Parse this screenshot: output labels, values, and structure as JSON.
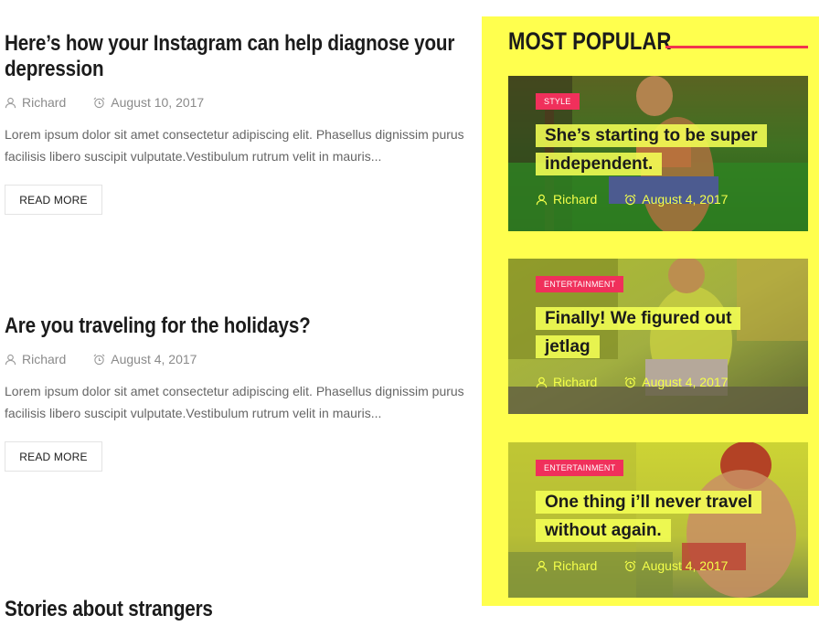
{
  "posts": [
    {
      "title": "Here’s how your Instagram can help diagnose your depression",
      "author": "Richard",
      "date": "August 10, 2017",
      "excerpt": "Lorem ipsum dolor sit amet consectetur adipiscing elit. Phasellus dignissim purus facilisis libero suscipit vulputate.Vestibulum rutrum velit in mauris...",
      "read_more": "READ MORE"
    },
    {
      "title": "Are you traveling for the holidays?",
      "author": "Richard",
      "date": "August 4, 2017",
      "excerpt": "Lorem ipsum dolor sit amet consectetur adipiscing elit. Phasellus dignissim purus facilisis libero suscipit vulputate.Vestibulum rutrum velit in mauris...",
      "read_more": "READ MORE"
    },
    {
      "title": "Stories about strangers"
    }
  ],
  "sidebar": {
    "title": "MOST POPULAR",
    "accent": "#f2344d",
    "background": "#ffff4e",
    "cards": [
      {
        "category": "STYLE",
        "title": "She’s starting to be super independent.",
        "author": "Richard",
        "date": "August 4, 2017"
      },
      {
        "category": "ENTERTAINMENT",
        "title": "Finally! We figured out jetlag",
        "author": "Richard",
        "date": "August 4, 2017"
      },
      {
        "category": "ENTERTAINMENT",
        "title": "One thing i’ll never travel without again.",
        "author": "Richard",
        "date": "August 4, 2017"
      }
    ]
  },
  "icons": {
    "author": "user-icon",
    "date": "alarm-clock-icon"
  }
}
